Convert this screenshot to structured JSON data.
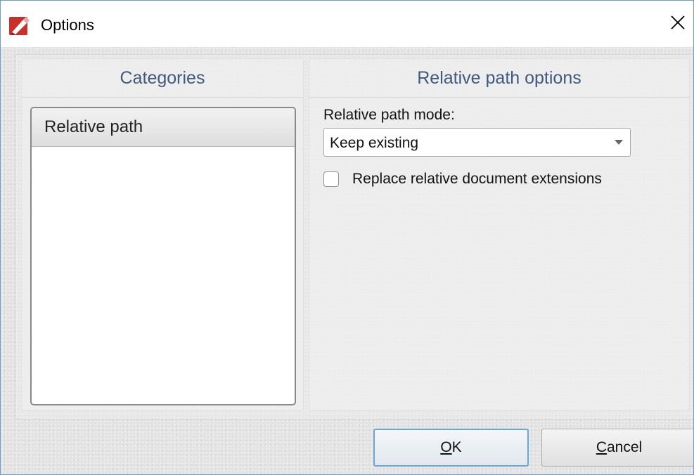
{
  "window": {
    "title": "Options",
    "app_icon": "pdf-editor-logo-icon",
    "close_icon": "close-icon"
  },
  "categories_panel": {
    "header": "Categories",
    "items": [
      {
        "label": "Relative path",
        "selected": true
      }
    ]
  },
  "options_panel": {
    "header": "Relative path options",
    "mode_label": "Relative path mode:",
    "mode_value": "Keep existing",
    "replace_extensions_label": "Replace relative document extensions",
    "replace_extensions_checked": false
  },
  "buttons": {
    "ok": {
      "accel": "O",
      "rest": "K"
    },
    "cancel": {
      "accel": "C",
      "rest": "ancel"
    }
  },
  "colors": {
    "header_text": "#3f5a7c",
    "default_button_border": "#6aa6d8",
    "window_border": "#6e9ad0"
  }
}
